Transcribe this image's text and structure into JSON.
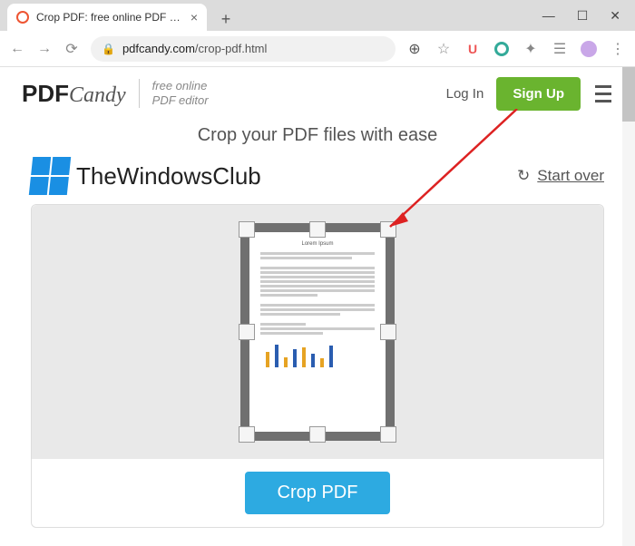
{
  "browser": {
    "tab_title": "Crop PDF: free online PDF cropp",
    "url_host": "pdfcandy.com",
    "url_path": "/crop-pdf.html",
    "ext_u_label": "U"
  },
  "header": {
    "logo_bold": "PDF",
    "logo_script": "Candy",
    "tagline_line1": "free online",
    "tagline_line2": "PDF editor",
    "login": "Log In",
    "signup": "Sign Up"
  },
  "page": {
    "subtitle": "Crop your PDF files with ease",
    "watermark": "TheWindowsClub",
    "startover": "Start over",
    "doc_heading": "Lorem Ipsum",
    "crop_button": "Crop PDF"
  }
}
